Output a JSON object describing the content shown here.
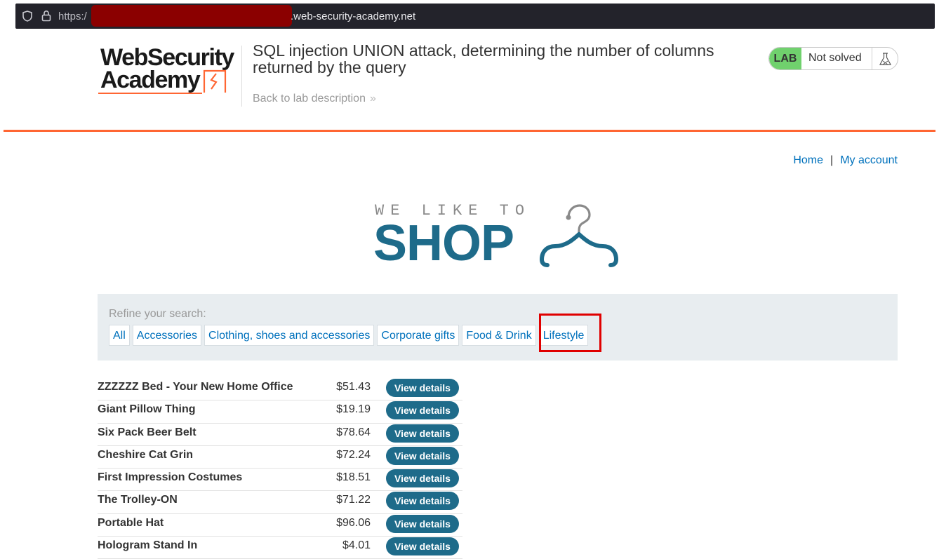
{
  "browser": {
    "scheme": "https:/",
    "host_suffix": ".web-security-academy.net"
  },
  "logo": {
    "line1": "WebSecurity",
    "line2": "Academy"
  },
  "lab": {
    "title": "SQL injection UNION attack, determining the number of columns returned by the query",
    "back_link": "Back to lab description",
    "badge": "LAB",
    "status": "Not solved",
    "badge_color": "#70d16d"
  },
  "nav": {
    "home": "Home",
    "separator": "|",
    "account": "My account"
  },
  "banner": {
    "tagline": "WE LIKE TO",
    "shop": "SHOP"
  },
  "filters": {
    "label": "Refine your search:",
    "categories": [
      "All",
      "Accessories",
      "Clothing, shoes and accessories",
      "Corporate gifts",
      "Food & Drink",
      "Lifestyle"
    ],
    "highlighted": "Lifestyle"
  },
  "products": [
    {
      "name": "ZZZZZZ Bed - Your New Home Office",
      "price": "$51.43",
      "action": "View details"
    },
    {
      "name": "Giant Pillow Thing",
      "price": "$19.19",
      "action": "View details"
    },
    {
      "name": "Six Pack Beer Belt",
      "price": "$78.64",
      "action": "View details"
    },
    {
      "name": "Cheshire Cat Grin",
      "price": "$72.24",
      "action": "View details"
    },
    {
      "name": "First Impression Costumes",
      "price": "$18.51",
      "action": "View details"
    },
    {
      "name": "The Trolley-ON",
      "price": "$71.22",
      "action": "View details"
    },
    {
      "name": "Portable Hat",
      "price": "$96.06",
      "action": "View details"
    },
    {
      "name": "Hologram Stand In",
      "price": "$4.01",
      "action": "View details"
    }
  ],
  "colors": {
    "accent_orange": "#ff6633",
    "link_blue": "#0071bc",
    "button_blue": "#1e6b8a",
    "highlight_red": "#e00000"
  }
}
